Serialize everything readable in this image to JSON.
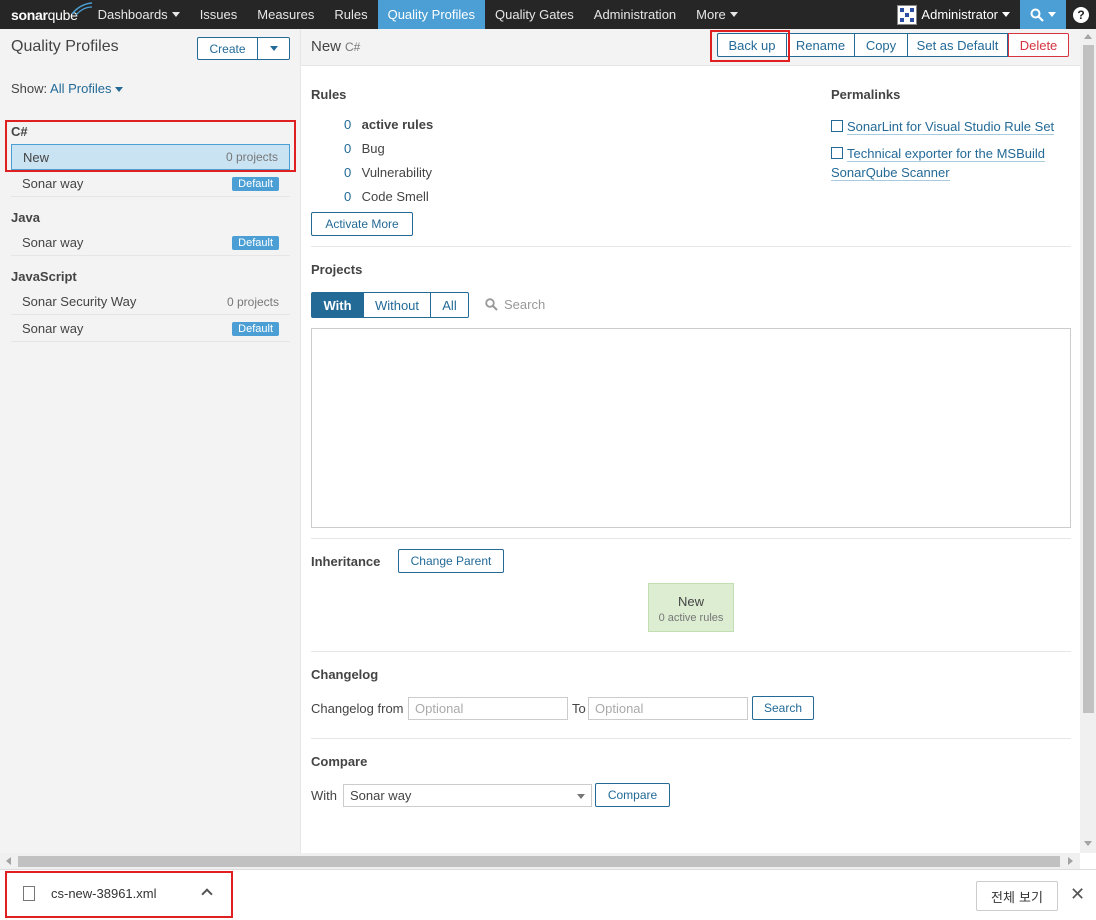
{
  "nav": {
    "logo_a": "sonar",
    "logo_b": "qube",
    "items": [
      {
        "label": "Dashboards",
        "caret": true
      },
      {
        "label": "Issues"
      },
      {
        "label": "Measures"
      },
      {
        "label": "Rules"
      },
      {
        "label": "Quality Profiles",
        "active": true
      },
      {
        "label": "Quality Gates"
      },
      {
        "label": "Administration"
      },
      {
        "label": "More",
        "caret": true
      }
    ],
    "user": "Administrator",
    "help": "?"
  },
  "sidebar": {
    "title": "Quality Profiles",
    "create_label": "Create",
    "show_label": "Show:",
    "show_value": "All Profiles",
    "languages": [
      {
        "name": "C#",
        "profiles": [
          {
            "name": "New",
            "meta": "0 projects",
            "selected": true
          },
          {
            "name": "Sonar way",
            "badge": "Default"
          }
        ]
      },
      {
        "name": "Java",
        "profiles": [
          {
            "name": "Sonar way",
            "badge": "Default"
          }
        ]
      },
      {
        "name": "JavaScript",
        "profiles": [
          {
            "name": "Sonar Security Way",
            "meta": "0 projects"
          },
          {
            "name": "Sonar way",
            "badge": "Default"
          }
        ]
      }
    ]
  },
  "header": {
    "title": "New",
    "language": "C#",
    "actions": {
      "backup": "Back up",
      "rename": "Rename",
      "copy": "Copy",
      "set_default": "Set as Default",
      "delete": "Delete"
    }
  },
  "rules": {
    "title": "Rules",
    "rows": [
      {
        "count": "0",
        "label": "active rules"
      },
      {
        "count": "0",
        "label": "Bug"
      },
      {
        "count": "0",
        "label": "Vulnerability"
      },
      {
        "count": "0",
        "label": "Code Smell"
      }
    ],
    "activate_more": "Activate More"
  },
  "permalinks": {
    "title": "Permalinks",
    "links": [
      "SonarLint for Visual Studio Rule Set",
      "Technical exporter for the MSBuild",
      "SonarQube Scanner"
    ]
  },
  "projects": {
    "title": "Projects",
    "filters": [
      "With",
      "Without",
      "All"
    ],
    "search_placeholder": "Search"
  },
  "inheritance": {
    "title": "Inheritance",
    "change_parent": "Change Parent",
    "node_name": "New",
    "node_rules": "0 active rules"
  },
  "changelog": {
    "title": "Changelog",
    "from_label": "Changelog from",
    "from_placeholder": "Optional",
    "to_label": "To",
    "to_placeholder": "Optional",
    "search_label": "Search"
  },
  "compare": {
    "title": "Compare",
    "with_label": "With",
    "selected": "Sonar way",
    "button": "Compare"
  },
  "download": {
    "filename": "cs-new-38961.xml",
    "show_all": "전체 보기"
  },
  "colors": {
    "accent": "#4b9fd5",
    "link": "#236a97",
    "nav_bg": "#262626",
    "danger": "#d4333f",
    "highlight": "#e02020"
  }
}
